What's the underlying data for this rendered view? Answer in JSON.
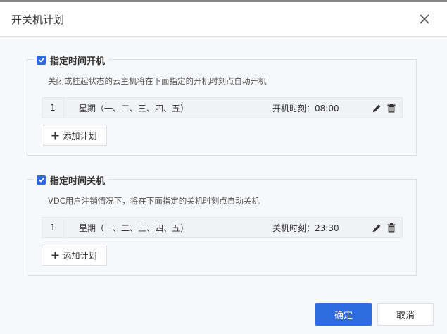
{
  "dialog": {
    "title": "开关机计划",
    "close_icon": "close-icon"
  },
  "colors": {
    "primary": "#2f6be0",
    "border": "#dcdfe6",
    "panel_bg": "#f7f8fa"
  },
  "power_on": {
    "checked": true,
    "label": "指定时间开机",
    "description": "关闭或挂起状态的云主机将在下面指定的开机时刻点自动开机",
    "plans": [
      {
        "index": "1",
        "days": "星期（一、二、三、四、五）",
        "time_label": "开机时刻：08:00"
      }
    ],
    "add_label": "添加计划"
  },
  "power_off": {
    "checked": true,
    "label": "指定时间关机",
    "description": "VDC用户注销情况下，将在下面指定的关机时刻点自动关机",
    "plans": [
      {
        "index": "1",
        "days": "星期（一、二、三、四、五）",
        "time_label": "关机时刻：23:30"
      }
    ],
    "add_label": "添加计划"
  },
  "footer": {
    "confirm_label": "确定",
    "cancel_label": "取消"
  }
}
